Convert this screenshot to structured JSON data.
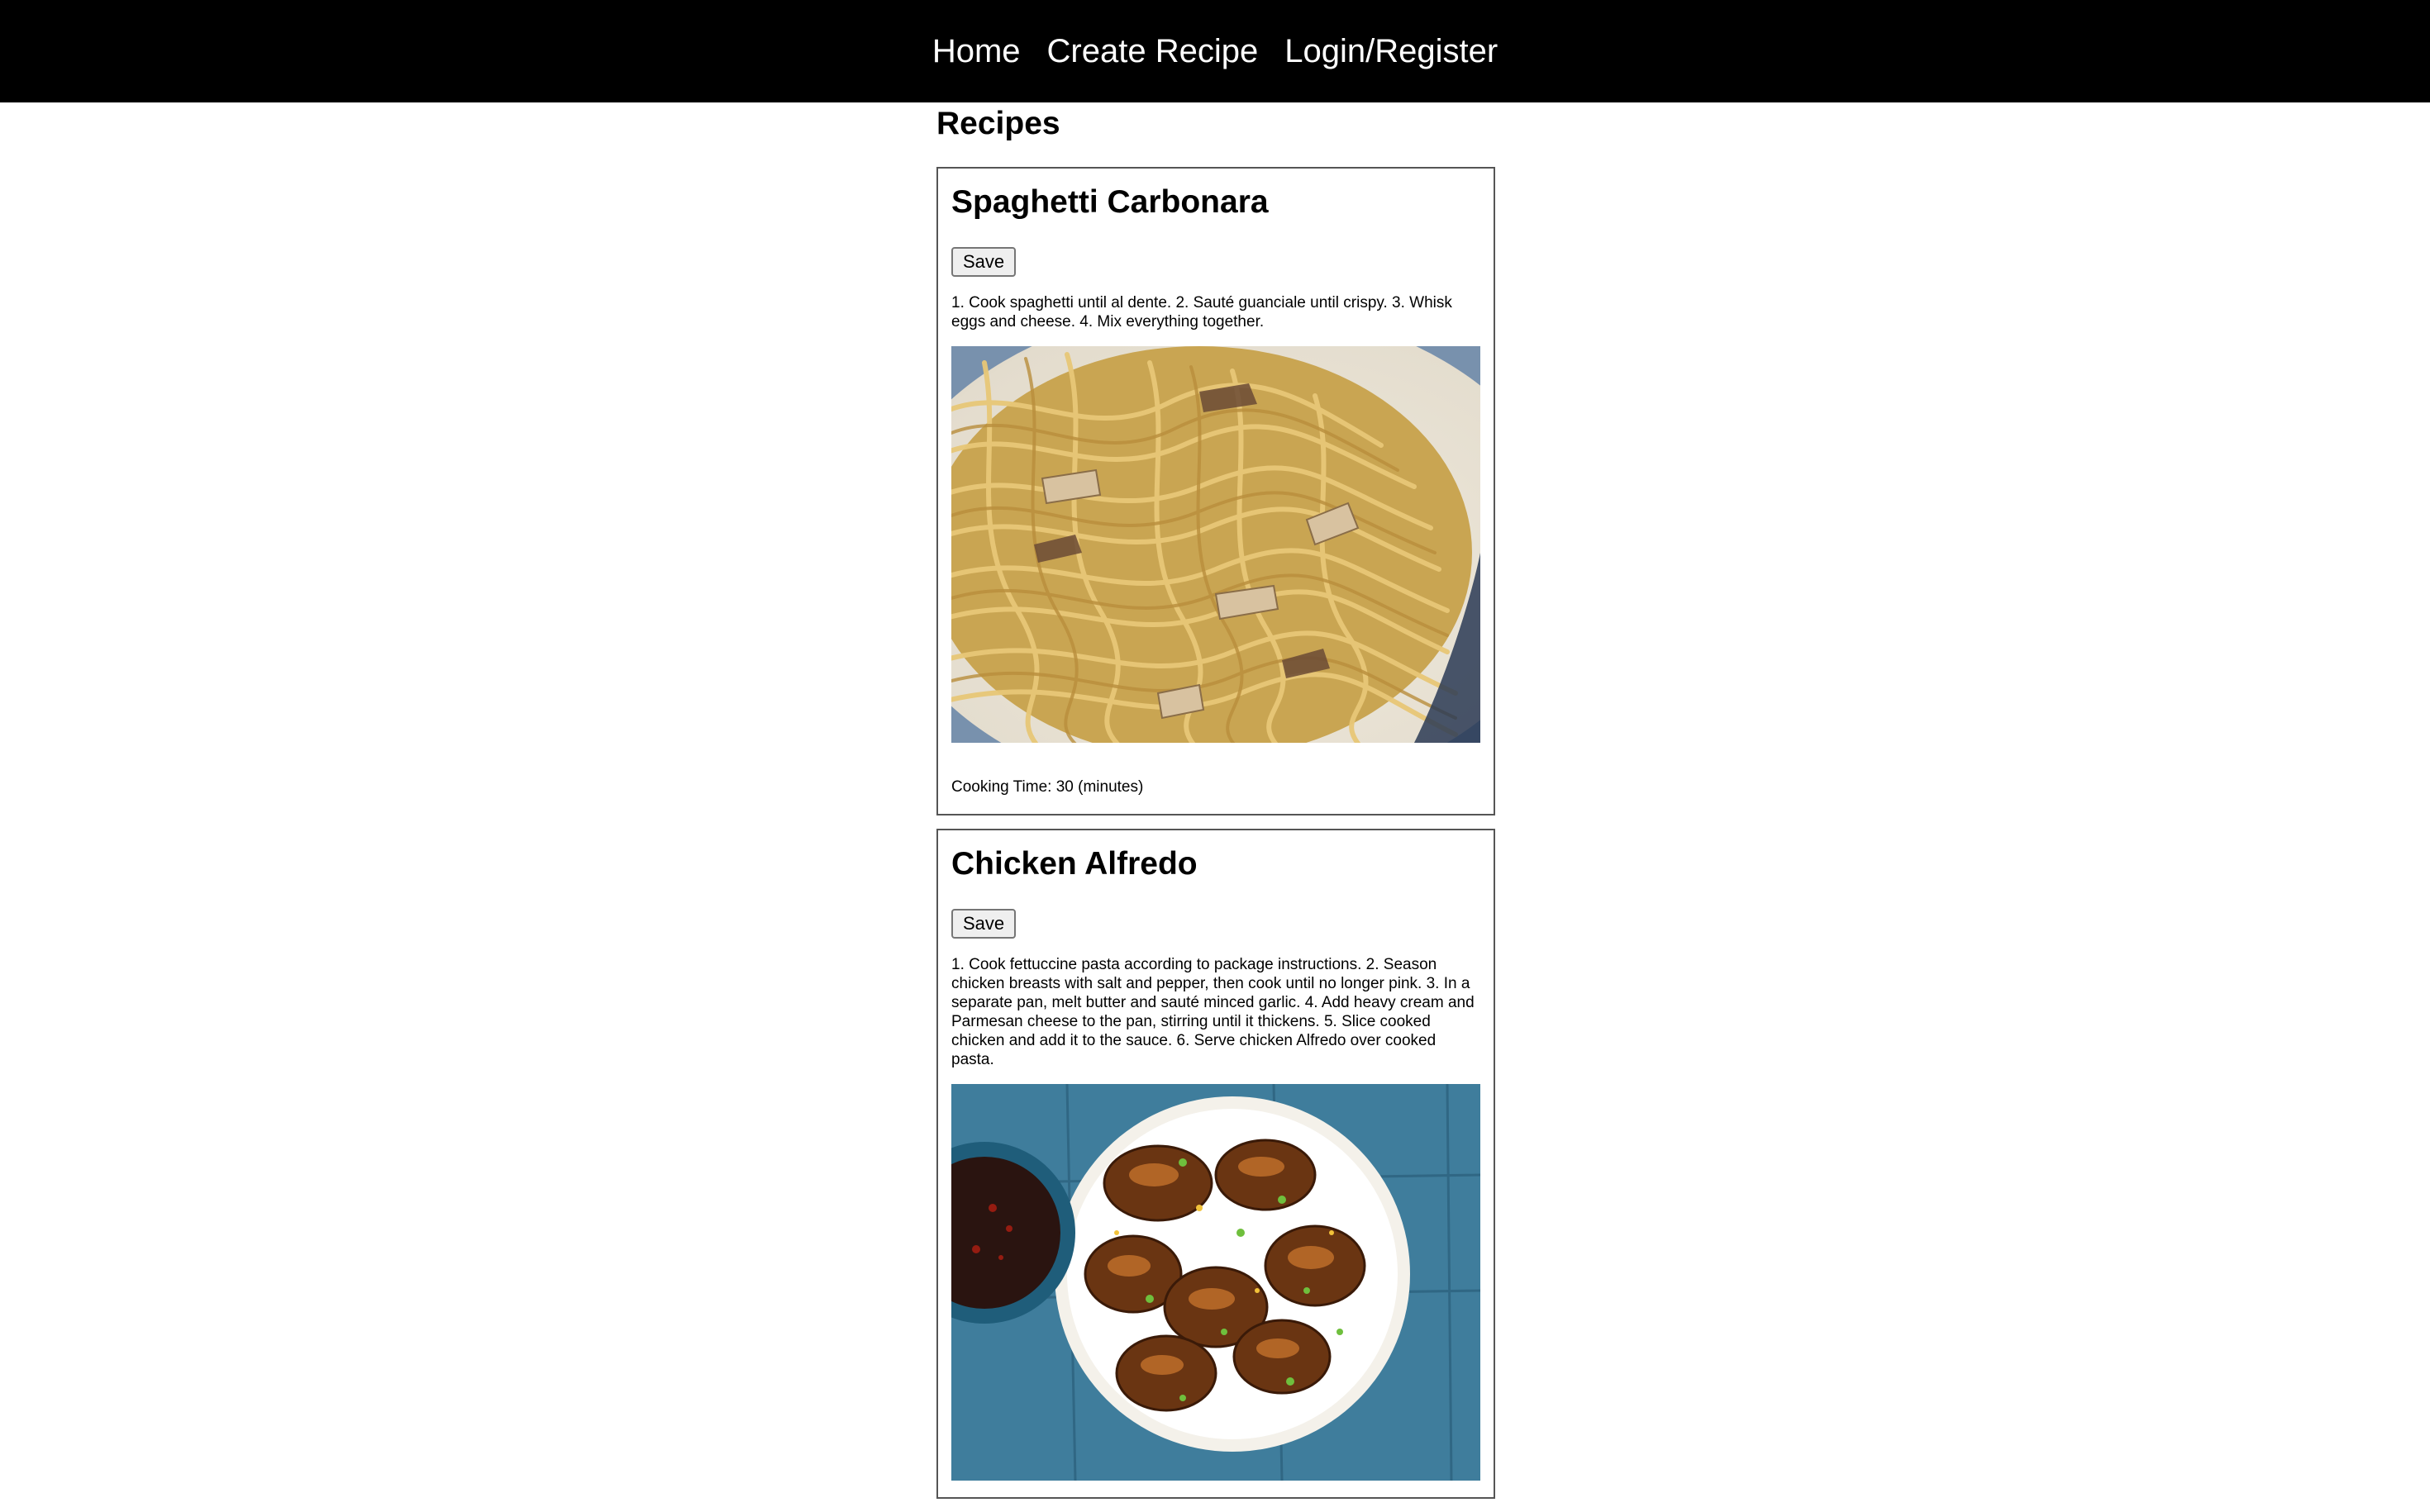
{
  "nav": {
    "home": "Home",
    "create_recipe": "Create Recipe",
    "login_register": "Login/Register"
  },
  "page": {
    "title": "Recipes"
  },
  "recipes": [
    {
      "name": "Spaghetti Carbonara",
      "save_label": "Save",
      "instructions": "1. Cook spaghetti until al dente. 2. Sauté guanciale until crispy. 3. Whisk eggs and cheese. 4. Mix everything together.",
      "image_alt": "Spaghetti Carbonara",
      "cooking_time": "Cooking Time: 30 (minutes)"
    },
    {
      "name": "Chicken Alfredo",
      "save_label": "Save",
      "instructions": "1. Cook fettuccine pasta according to package instructions. 2. Season chicken breasts with salt and pepper, then cook until no longer pink. 3. In a separate pan, melt butter and sauté minced garlic. 4. Add heavy cream and Parmesan cheese to the pan, stirring until it thickens. 5. Slice cooked chicken and add it to the sauce. 6. Serve chicken Alfredo over cooked pasta.",
      "image_alt": "Chicken Alfredo"
    }
  ],
  "colors": {
    "navbar_bg": "#000000",
    "nav_text": "#ffffff",
    "card_border": "#555555"
  }
}
